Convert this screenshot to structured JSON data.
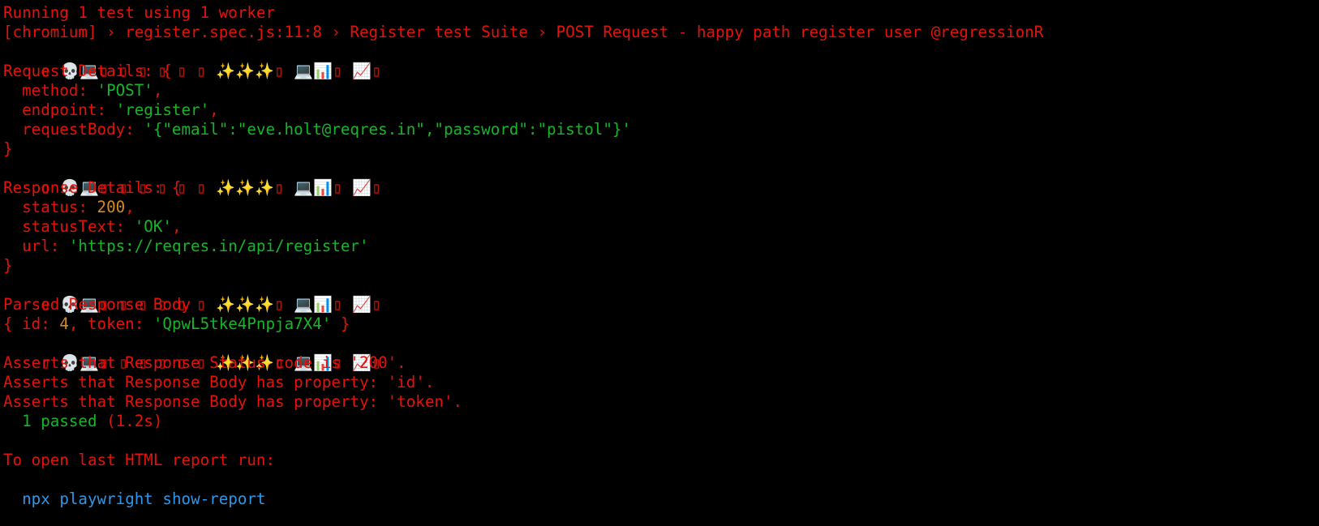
{
  "terminal": {
    "running": {
      "pre": "Running ",
      "n1": "1",
      "mid": " test using ",
      "n2": "1",
      "post": " worker"
    },
    "test_title": "[chromium] › register.spec.js:11:8 › Register test Suite › POST Request - happy path register user @regressionR",
    "icon_row": [
      "▯",
      "💀",
      "💻",
      "▯",
      "▯",
      "▯",
      "▯",
      "▯",
      "▯",
      "✨",
      "✨",
      "✨",
      "▯",
      "💻",
      "📊",
      "▯",
      "📈",
      "▯"
    ],
    "request": {
      "header": "Request Details: {",
      "method_key": "  method: ",
      "method_val": "'POST'",
      "method_comma": ",",
      "endpoint_key": "  endpoint: ",
      "endpoint_val": "'register'",
      "endpoint_comma": ",",
      "body_key": "  requestBody: ",
      "body_val": "'{\"email\":\"eve.holt@reqres.in\",\"password\":\"pistol\"}'",
      "close": "}"
    },
    "response": {
      "header": "Response Details: {",
      "status_key": "  status: ",
      "status_val": "200",
      "status_comma": ",",
      "statustext_key": "  statusText: ",
      "statustext_val": "'OK'",
      "statustext_comma": ",",
      "url_key": "  url: ",
      "url_val": "'https://reqres.in/api/register'",
      "close": "}"
    },
    "parsed": {
      "header": "Parsed Response Body",
      "open": "{ id: ",
      "id_val": "4",
      "token_key": ", token: ",
      "token_val": "'QpwL5tke4Pnpja7X4'",
      "close": " }"
    },
    "asserts": [
      "Asserts that Response Status code is '200'.",
      "Asserts that Response Body has property: 'id'.",
      "Asserts that Response Body has property: 'token'."
    ],
    "passed": {
      "text": "  1 passed ",
      "time": "(1.2s)"
    },
    "report_hint": "To open last HTML report run:",
    "command": {
      "npx": "npx",
      "playwright": "playwright",
      "show_report": "show-report"
    }
  }
}
